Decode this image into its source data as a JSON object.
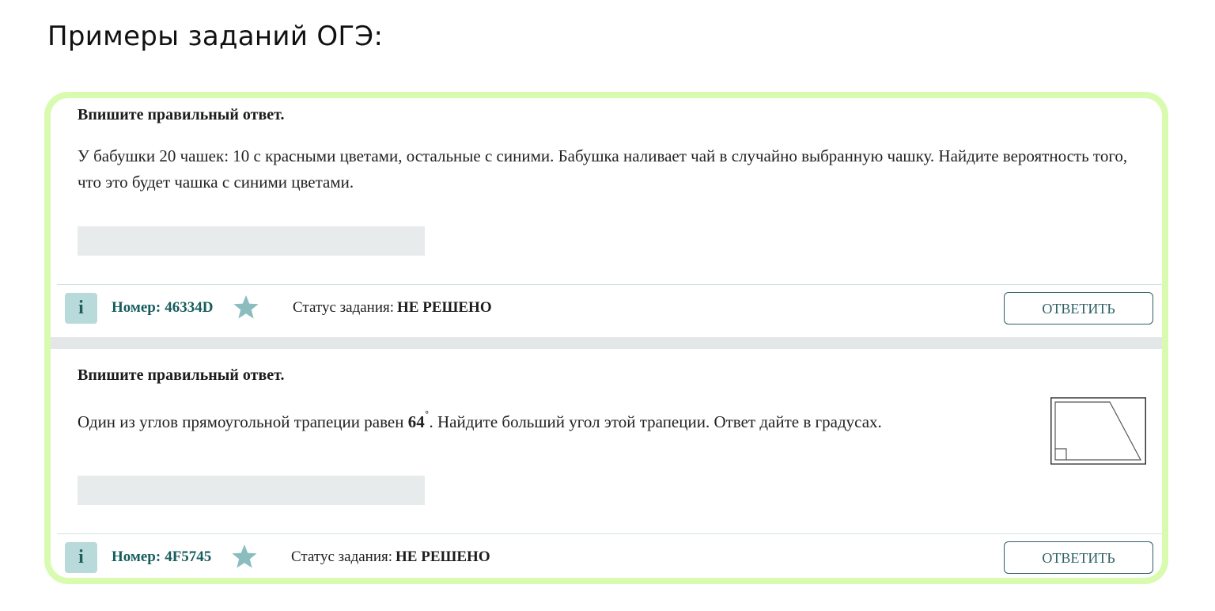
{
  "page": {
    "heading": "Примеры заданий ОГЭ:"
  },
  "colors": {
    "frame_border": "#d9fbb0",
    "info_button_bg": "#b8dada",
    "accent_teal": "#175d5d",
    "star": "#8bbdbf",
    "answer_field_bg": "#e8ebec"
  },
  "tasks": [
    {
      "instruction": "Впишите правильный ответ.",
      "question_line1": "У бабушки 20 чашек: 10 с красными цветами, остальные с синими. Бабушка наливает чай в случайно выбранную чашку. Найдите вероятность того,",
      "question_line2": "что это будет чашка с синими цветами.",
      "answer_value": "",
      "info_label": "i",
      "number_label": "Номер:",
      "number_value": "46334D",
      "star_icon": "star-icon",
      "status_label": "Статус задания:",
      "status_value": "НЕ РЕШЕНО",
      "answer_button": "ОТВЕТИТЬ"
    },
    {
      "instruction": "Впишите правильный ответ.",
      "question_before": "Один из углов прямоугольной трапеции равен ",
      "angle": "64",
      "degree_sign": "˚",
      "question_after": ". Найдите больший угол этой трапеции. Ответ дайте в градусах.",
      "figure_icon": "right-trapezoid-figure",
      "answer_value": "",
      "info_label": "i",
      "number_label": "Номер:",
      "number_value": "4F5745",
      "star_icon": "star-icon",
      "status_label": "Статус задания:",
      "status_value": "НЕ РЕШЕНО",
      "answer_button": "ОТВЕТИТЬ"
    }
  ]
}
